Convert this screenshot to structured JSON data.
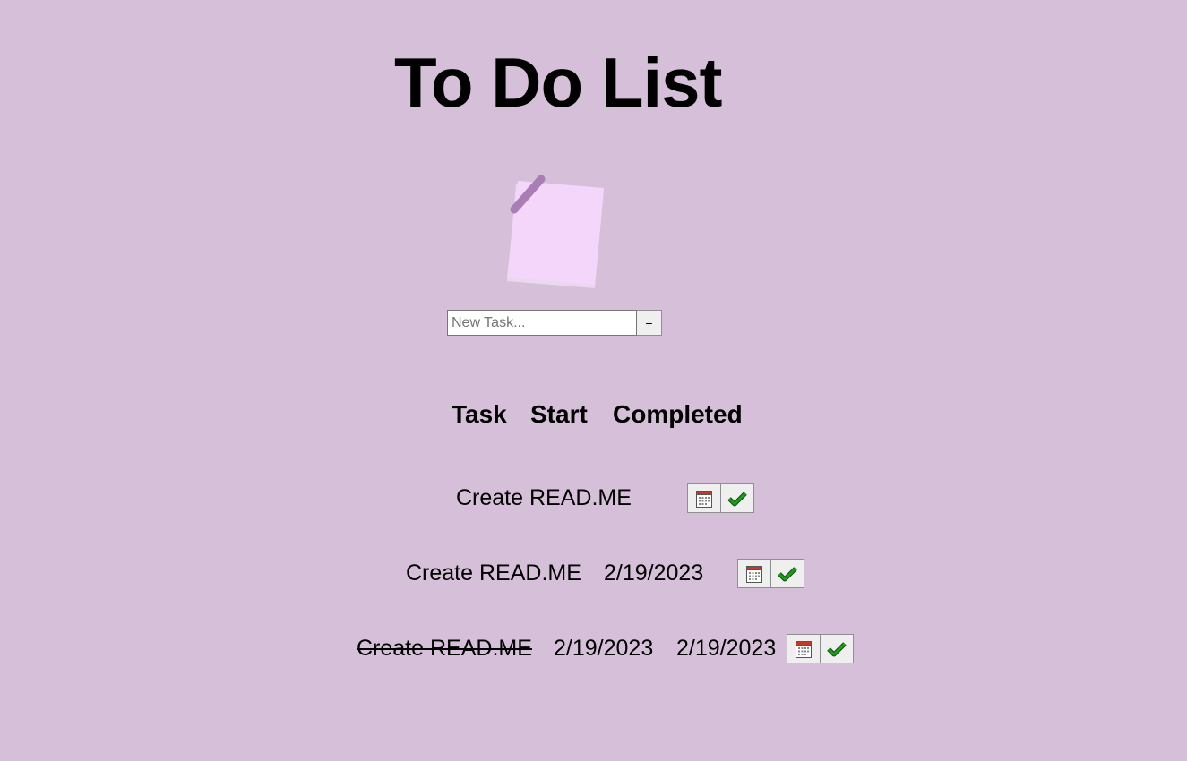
{
  "page": {
    "title": "To Do List"
  },
  "new_task": {
    "placeholder": "New Task...",
    "add_label": "+"
  },
  "table": {
    "headers": {
      "task": "Task",
      "start": "Start",
      "completed": "Completed"
    }
  },
  "tasks": [
    {
      "name": "Create READ.ME",
      "start": "",
      "completed": "",
      "done": false
    },
    {
      "name": "Create READ.ME",
      "start": "2/19/2023",
      "completed": "",
      "done": false
    },
    {
      "name": "Create READ.ME",
      "start": "2/19/2023",
      "completed": "2/19/2023",
      "done": true
    }
  ],
  "icons": {
    "note": "sticky-note-icon",
    "start_button": "calendar-icon",
    "complete_button": "checkmark-icon"
  },
  "colors": {
    "background": "#d6bfd8",
    "note": "#f5d6fb",
    "tape": "#a97eb5",
    "check": "#1f9a1f",
    "calendar_header": "#c0392b"
  }
}
